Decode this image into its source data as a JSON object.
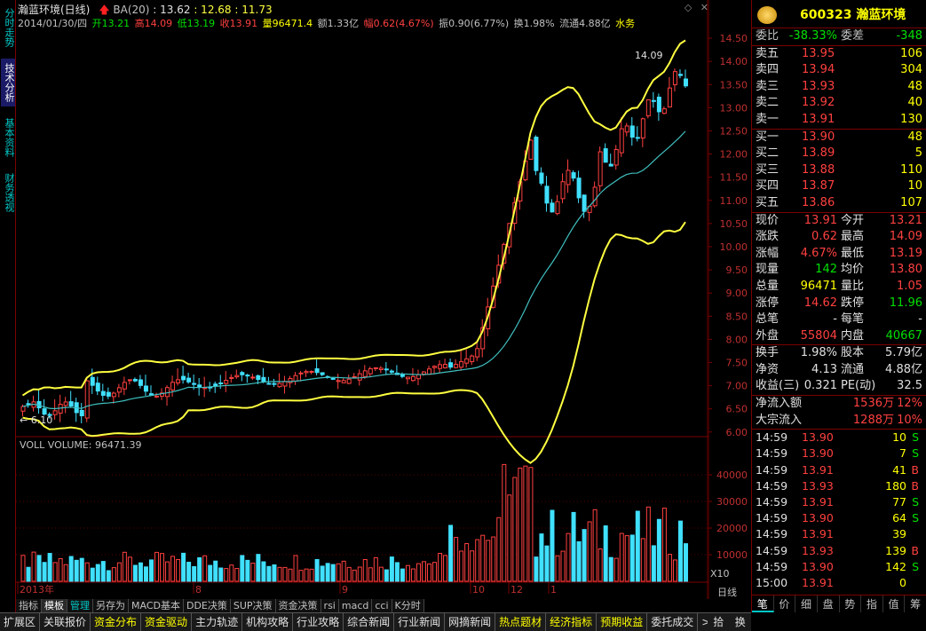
{
  "vtabs": [
    "分时走势",
    "技术分析",
    "基本资料",
    "财务透视"
  ],
  "header": {
    "stock": "瀚蓝环境(日线)",
    "indicator": "BA(20)",
    "ba_mid": ": 13.62",
    "ba_up": ": 12.68",
    "ba_dn": ": 11.73",
    "date": "2014/01/30/四",
    "open": "开13.21",
    "high": "高14.09",
    "low": "低13.19",
    "close": "收13.91",
    "volume": "量96471.4",
    "amount": "额1.33亿",
    "change": "幅0.62(4.67%)",
    "amplitude": "振0.90(6.77%)",
    "turnover": "换1.98%",
    "float": "流通4.88亿",
    "sector": "水务"
  },
  "chart": {
    "price_ticks": [
      "14.50",
      "14.00",
      "13.50",
      "13.00",
      "12.50",
      "12.00",
      "11.50",
      "11.00",
      "10.50",
      "10.00",
      "9.50",
      "9.00",
      "8.50",
      "8.00",
      "7.50",
      "7.00",
      "6.50",
      "6.00"
    ],
    "vol_ticks": [
      "40000",
      "30000",
      "20000",
      "10000"
    ],
    "vol_unit": "X10",
    "hi_label": "14.09",
    "lo_label": "6.10",
    "x_labels": [
      "2013年",
      "8",
      "9",
      "10",
      "12",
      "1"
    ],
    "volume_title": "VOLL  VOLUME: 96471.39",
    "period": "日线"
  },
  "chart_data": {
    "type": "candlestick",
    "title": "",
    "ylim": [
      5.9,
      14.75
    ],
    "vol_ylim": [
      0,
      50000
    ],
    "series_names": [
      "BA(20)"
    ]
  },
  "quote": {
    "code_name": "600323 瀚蓝环境",
    "weibi_label": "委比",
    "weibi": "-38.33%",
    "weicha_label": "委差",
    "weicha": "-348",
    "asks": [
      {
        "label": "卖五",
        "price": "13.95",
        "vol": "106"
      },
      {
        "label": "卖四",
        "price": "13.94",
        "vol": "304"
      },
      {
        "label": "卖三",
        "price": "13.93",
        "vol": "48"
      },
      {
        "label": "卖二",
        "price": "13.92",
        "vol": "40"
      },
      {
        "label": "卖一",
        "price": "13.91",
        "vol": "130"
      }
    ],
    "bids": [
      {
        "label": "买一",
        "price": "13.90",
        "vol": "48"
      },
      {
        "label": "买二",
        "price": "13.89",
        "vol": "5"
      },
      {
        "label": "买三",
        "price": "13.88",
        "vol": "110"
      },
      {
        "label": "买四",
        "price": "13.87",
        "vol": "10"
      },
      {
        "label": "买五",
        "price": "13.86",
        "vol": "107"
      }
    ],
    "stats": [
      {
        "k1": "现价",
        "v1": "13.91",
        "c1": "red",
        "k2": "今开",
        "v2": "13.21",
        "c2": "red"
      },
      {
        "k1": "涨跌",
        "v1": "0.62",
        "c1": "red",
        "k2": "最高",
        "v2": "14.09",
        "c2": "red"
      },
      {
        "k1": "涨幅",
        "v1": "4.67%",
        "c1": "red",
        "k2": "最低",
        "v2": "13.19",
        "c2": "red"
      },
      {
        "k1": "现量",
        "v1": "142",
        "c1": "grn",
        "k2": "均价",
        "v2": "13.80",
        "c2": "red"
      },
      {
        "k1": "总量",
        "v1": "96471",
        "c1": "yel",
        "k2": "量比",
        "v2": "1.05",
        "c2": "red"
      },
      {
        "k1": "涨停",
        "v1": "14.62",
        "c1": "red",
        "k2": "跌停",
        "v2": "11.96",
        "c2": "grn"
      },
      {
        "k1": "总笔",
        "v1": "-",
        "c1": "wht",
        "k2": "每笔",
        "v2": "-",
        "c2": "wht"
      },
      {
        "k1": "外盘",
        "v1": "55804",
        "c1": "red",
        "k2": "内盘",
        "v2": "40667",
        "c2": "grn"
      }
    ],
    "stats2": [
      {
        "k1": "换手",
        "v1": "1.98%",
        "k2": "股本",
        "v2": "5.79亿"
      },
      {
        "k1": "净资",
        "v1": "4.13",
        "k2": "流通",
        "v2": "4.88亿"
      },
      {
        "k1": "收益(三)",
        "v1": "0.321",
        "k2": "PE(动)",
        "v2": "32.5"
      }
    ],
    "flow": [
      {
        "k": "净流入额",
        "v": "1536万",
        "p": "12%"
      },
      {
        "k": "大宗流入",
        "v": "1288万",
        "p": "10%"
      }
    ],
    "ticks": [
      {
        "t": "14:59",
        "p": "13.90",
        "v": "10",
        "s": "S"
      },
      {
        "t": "14:59",
        "p": "13.90",
        "v": "7",
        "s": "S"
      },
      {
        "t": "14:59",
        "p": "13.91",
        "v": "41",
        "s": "B"
      },
      {
        "t": "14:59",
        "p": "13.93",
        "v": "180",
        "s": "B"
      },
      {
        "t": "14:59",
        "p": "13.91",
        "v": "77",
        "s": "S"
      },
      {
        "t": "14:59",
        "p": "13.90",
        "v": "64",
        "s": "S"
      },
      {
        "t": "14:59",
        "p": "13.91",
        "v": "39",
        "s": ""
      },
      {
        "t": "14:59",
        "p": "13.93",
        "v": "139",
        "s": "B"
      },
      {
        "t": "14:59",
        "p": "13.90",
        "v": "142",
        "s": "S"
      },
      {
        "t": "15:00",
        "p": "13.91",
        "v": "0",
        "s": ""
      }
    ],
    "tabs": [
      "笔",
      "价",
      "细",
      "盘",
      "势",
      "指",
      "值",
      "筹"
    ]
  },
  "bottom_tabs1": [
    "指标",
    "模板",
    "管理",
    "另存为",
    "MACD基本",
    "DDE决策",
    "SUP决策",
    "资金决策",
    "rsi",
    "macd",
    "cci",
    "K分时"
  ],
  "bottom_tabs2": [
    "扩展区",
    "关联报价",
    "资金分布",
    "资金驱动",
    "主力轨迹",
    "机构攻略",
    "行业攻略",
    "综合新闻",
    "行业新闻",
    "网摘新闻",
    "热点题材",
    "经济指标",
    "预期收益",
    "委托成交"
  ],
  "bottom_right": [
    "拾",
    "换"
  ],
  "more_btn": ">>",
  "colors": {
    "up": "#ff4040",
    "down": "#40e0ff",
    "ma_yellow": "#ffff40",
    "ma_cyan": "#40c0c0",
    "grid": "#7a0000"
  }
}
